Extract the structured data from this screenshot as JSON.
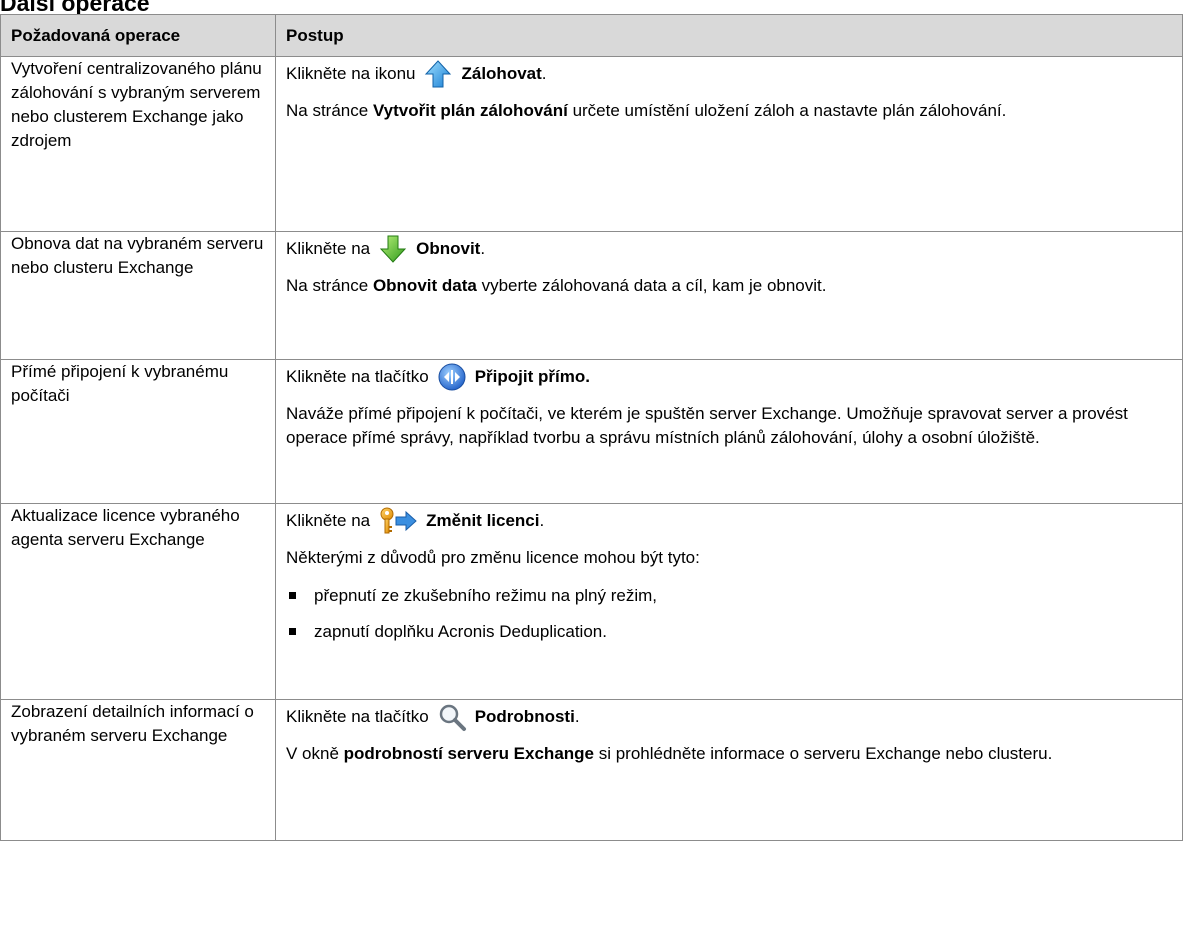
{
  "heading": "Další operace",
  "table": {
    "headers": [
      "Požadovaná operace",
      "Postup"
    ],
    "rows": [
      {
        "operation": "Vytvoření centralizovaného plánu zálohování s vybraným serverem nebo clusterem Exchange jako zdrojem",
        "action_prefix": "Klikněte na ikonu",
        "action_icon": "arrow-up-icon",
        "action_label": "Zálohovat",
        "action_suffix": ".",
        "detail": {
          "before": "Na stránce ",
          "bold": "Vytvořit plán zálohování",
          "after": " určete umístění uložení záloh a nastavte plán zálohování."
        }
      },
      {
        "operation": "Obnova dat na vybraném serveru nebo clusteru Exchange",
        "action_prefix": "Klikněte na",
        "action_icon": "arrow-down-icon",
        "action_label": "Obnovit",
        "action_suffix": ".",
        "detail": {
          "before": "Na stránce ",
          "bold": "Obnovit data",
          "after": " vyberte zálohovaná data a cíl, kam je obnovit."
        }
      },
      {
        "operation": "Přímé připojení k vybranému počítači",
        "action_prefix": "Klikněte na tlačítko",
        "action_icon": "connect-icon",
        "action_label": "Připojit přímo.",
        "action_suffix": "",
        "detail_text": "Naváže přímé připojení k počítači, ve kterém je spuštěn server Exchange. Umožňuje spravovat server a provést operace přímé správy, například tvorbu a správu místních plánů zálohování, úlohy a osobní úložiště."
      },
      {
        "operation": "Aktualizace licence vybraného agenta serveru Exchange",
        "action_prefix": "Klikněte na",
        "action_icon": "key-icon",
        "action_label": "Změnit licenci",
        "action_suffix": ".",
        "detail_text": "Některými z důvodů pro změnu licence mohou být tyto:",
        "bullets": [
          "přepnutí ze zkušebního režimu na plný režim,",
          "zapnutí doplňku Acronis Deduplication."
        ]
      },
      {
        "operation": "Zobrazení detailních informací o vybraném serveru Exchange",
        "action_prefix": "Klikněte na tlačítko",
        "action_icon": "magnifier-icon",
        "action_label": "Podrobnosti",
        "action_suffix": ".",
        "detail": {
          "before": "V okně ",
          "bold": "podrobností serveru Exchange",
          "after": " si prohlédněte informace o serveru Exchange nebo clusteru."
        }
      }
    ]
  }
}
